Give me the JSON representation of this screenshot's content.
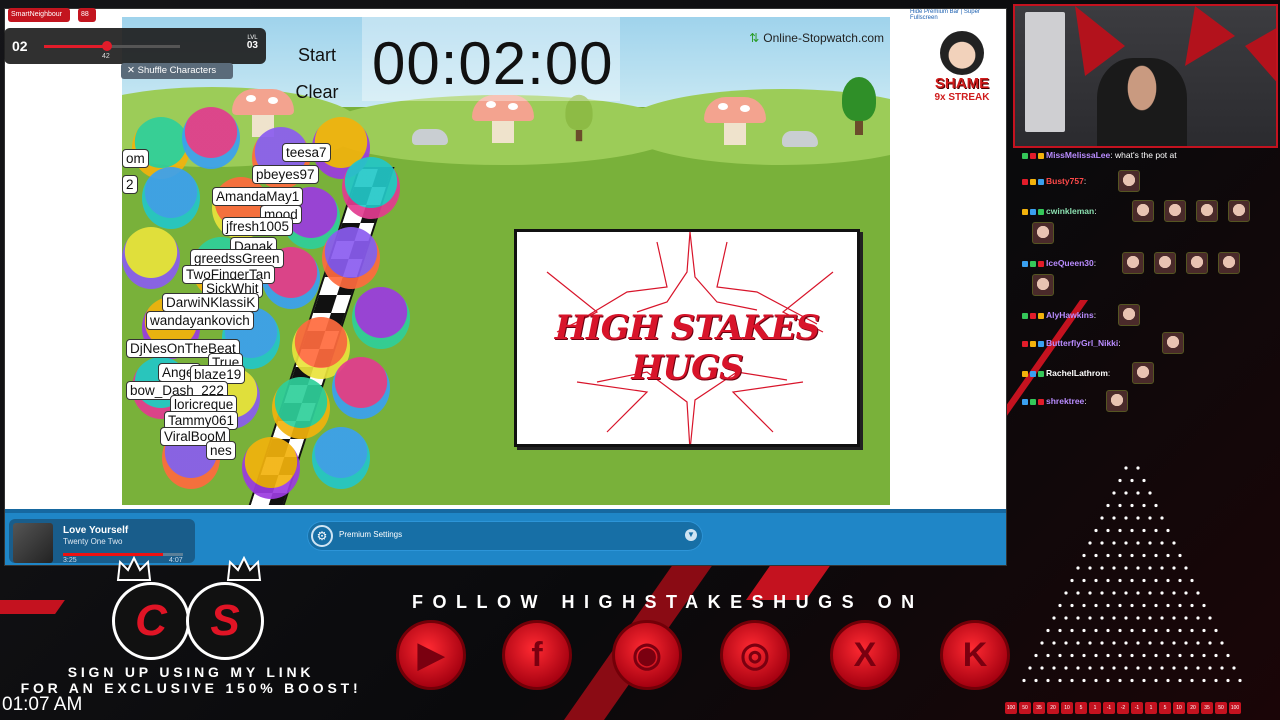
{
  "stream": {
    "clock": "01:07 AM",
    "hud": {
      "level_current": "02",
      "xp": "42",
      "xp_fraction": 0.45,
      "level_label": "LVL",
      "level_next": "03"
    },
    "top_chips": [
      "SmartNeighbour",
      "88"
    ],
    "shuffle_label": "Shuffle Characters"
  },
  "game": {
    "start_label": "Start",
    "clear_label": "Clear",
    "timer": "00:02:00",
    "brand": "Online-Stopwatch.com",
    "top_link": "Hide Premium Bar | Super Fullscreen",
    "shame_label": "SHAME",
    "shame_streak": "9x STREAK",
    "racers": [
      "om",
      "2",
      "teesa7",
      "pbeyes97",
      "AmandaMay1",
      "mood",
      "jfresh1005",
      "Danak",
      "greedssGreen",
      "TwoFingerTan",
      "SickWhit",
      "DarwiNKlassiK",
      "wandayankovich",
      "DjNesOnTheBeat",
      "True",
      "Angel",
      "blaze19",
      "bow_Dash_222",
      "loricreque",
      "Tammy061",
      "ViralBooM",
      "nes"
    ],
    "logo_text": "HIGH STAKES HUGS"
  },
  "player": {
    "song_title": "Love Yourself",
    "song_artist": "Twenty One Two",
    "time_elapsed": "3:25",
    "time_total": "4:07",
    "progress": 0.83,
    "premium_label": "Premium Settings"
  },
  "chat": {
    "messages": [
      {
        "user": "MissMelissaLee",
        "text": ": what's the pot at",
        "color": "#b98cff"
      },
      {
        "user": "Busty757",
        "text": ":",
        "color": "#ff4a4a"
      },
      {
        "user": "cwinkleman",
        "text": ":",
        "color": "#8be0b0"
      },
      {
        "user": "IceQueen30",
        "text": ":",
        "color": "#b98cff"
      },
      {
        "user": "AlyHawkins",
        "text": ":",
        "color": "#b98cff"
      },
      {
        "user": "ButterflyGrl_Nikki",
        "text": ":",
        "color": "#b98cff"
      },
      {
        "user": "RachelLathrom",
        "text": ":",
        "color": "#ffffff"
      },
      {
        "user": "shrektree",
        "text": ":",
        "color": "#b98cff"
      }
    ]
  },
  "overlay": {
    "follow_text": "FOLLOW HIGHSTAKESHUGS ON",
    "socials": [
      {
        "name": "youtube",
        "glyph": "▶"
      },
      {
        "name": "facebook",
        "glyph": "f"
      },
      {
        "name": "discord",
        "glyph": "◉"
      },
      {
        "name": "instagram",
        "glyph": "◎"
      },
      {
        "name": "x",
        "glyph": "X"
      },
      {
        "name": "kick",
        "glyph": "K"
      }
    ],
    "cs_left": "C",
    "cs_right": "S",
    "signup_line1": "SIGN UP USING MY LINK",
    "signup_line2": "FOR AN EXCLUSIVE 150% BOOST!",
    "multipliers": [
      "100",
      "50",
      "35",
      "20",
      "10",
      "5",
      "1",
      "-1",
      "-2",
      "-1",
      "1",
      "5",
      "10",
      "20",
      "35",
      "50",
      "100"
    ],
    "accent_color": "#c4121f"
  }
}
